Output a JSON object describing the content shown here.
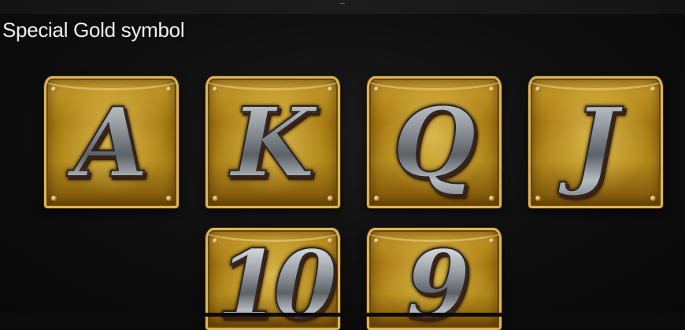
{
  "header": {
    "title": "Special Gold symbol"
  },
  "symbols": [
    {
      "label": "A"
    },
    {
      "label": "K"
    },
    {
      "label": "Q"
    },
    {
      "label": "J"
    },
    {
      "label": "10"
    },
    {
      "label": "9"
    }
  ],
  "colors": {
    "background": "#0b0b0b",
    "tile_gold": "#b48a1c",
    "tile_border": "#d9b45a",
    "glyph_silver": "#9aa0a6",
    "title_text": "#f2f2f2"
  }
}
